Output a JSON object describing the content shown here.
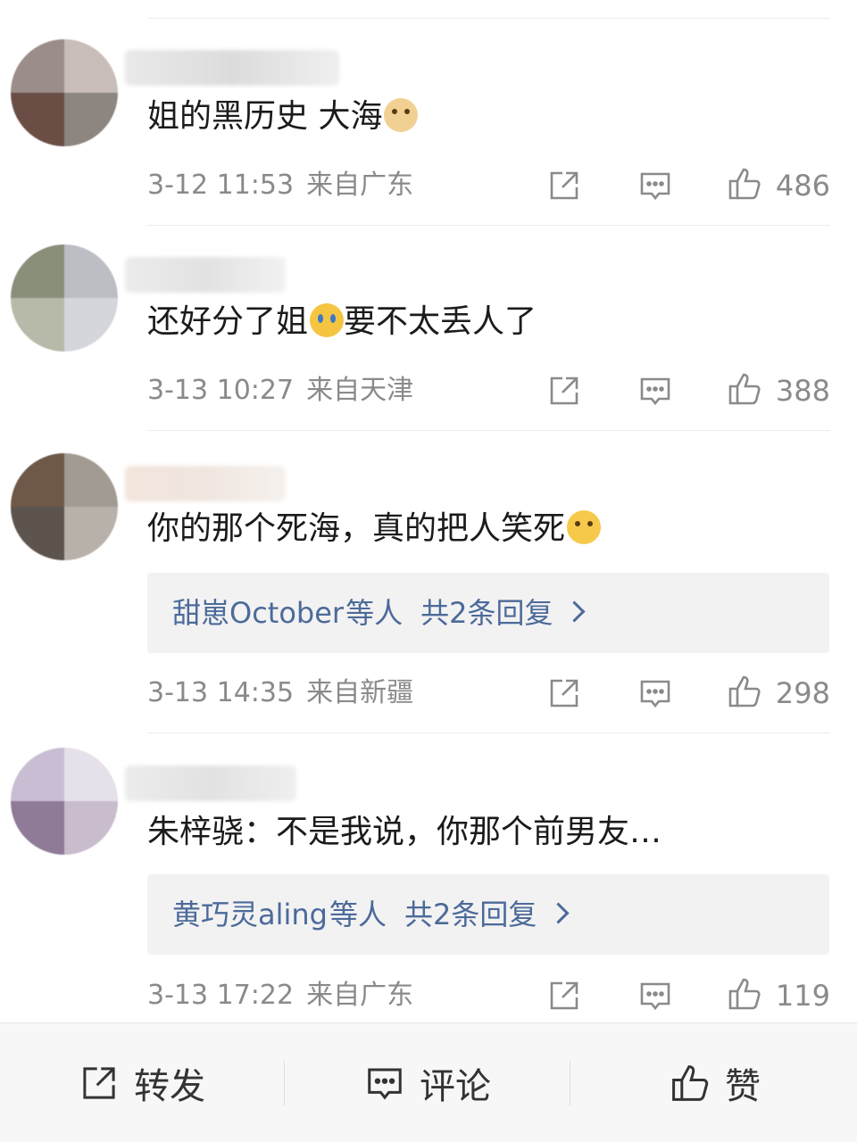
{
  "comments": [
    {
      "text": "姐的黑历史 大海",
      "emoji": "doge-emoji",
      "time": "3-12 11:53",
      "location": "来自广东",
      "likes": "486",
      "avatar_colors": [
        "#9b8e8a",
        "#c9bdb9",
        "#6a4d45",
        "#8d8580"
      ]
    },
    {
      "text": "还好分了姐",
      "emoji": "crying-emoji",
      "text_after": "要不太丢人了",
      "time": "3-13 10:27",
      "location": "来自天津",
      "likes": "388",
      "avatar_colors": [
        "#8a8f7a",
        "#bcbec4",
        "#b7baa9",
        "#d4d6dc"
      ]
    },
    {
      "text": "你的那个死海，真的把人笑死",
      "emoji": "laughing-emoji",
      "replies": {
        "users": "甜崽October",
        "suffix": "等人",
        "count": "共2条回复"
      },
      "time": "3-13 14:35",
      "location": "来自新疆",
      "likes": "298",
      "avatar_colors": [
        "#6e5848",
        "#a29b92",
        "#5e544e",
        "#b8b1aa"
      ]
    },
    {
      "text": "朱梓骁：不是我说，你那个前男友…",
      "replies": {
        "users": "黄巧灵aling",
        "suffix": "等人",
        "count": "共2条回复"
      },
      "time": "3-13 17:22",
      "location": "来自广东",
      "likes": "119",
      "avatar_colors": [
        "#c9bdd3",
        "#e6e0ea",
        "#8f7a98",
        "#c8bccd"
      ]
    }
  ],
  "bottom_bar": {
    "repost": "转发",
    "comment": "评论",
    "like": "赞"
  }
}
